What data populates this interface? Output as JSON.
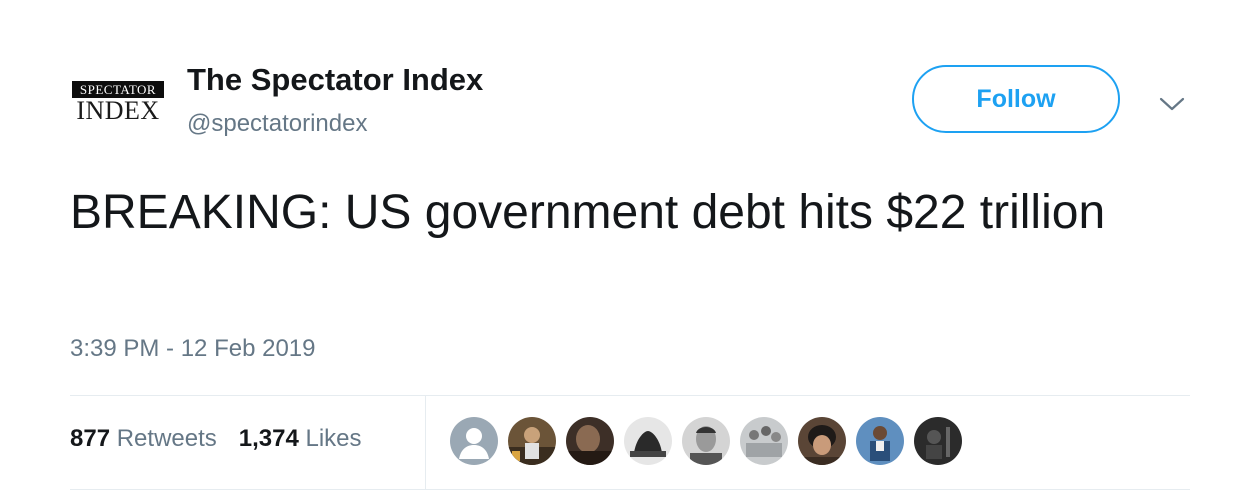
{
  "account": {
    "logo": {
      "top_text": "SPECTATOR",
      "bottom_text": "INDEX"
    },
    "name": "The Spectator Index",
    "handle": "@spectatorindex"
  },
  "follow_button": {
    "label": "Follow",
    "color": "#1da1f2"
  },
  "tweet": {
    "text": "BREAKING: US government debt hits $22 trillion",
    "timestamp": "3:39 PM - 12 Feb 2019"
  },
  "stats": {
    "retweets_count": "877",
    "retweets_label": "Retweets",
    "likes_count": "1,374",
    "likes_label": "Likes"
  },
  "likers": [
    {
      "name": "default-avatar",
      "color": "#9aa8b4"
    },
    {
      "name": "liker-avatar-2",
      "color": "#5b4a35"
    },
    {
      "name": "liker-avatar-3",
      "color": "#3d2f27"
    },
    {
      "name": "liker-avatar-4",
      "color": "#d8d8d8"
    },
    {
      "name": "liker-avatar-5",
      "color": "#cfcfcf"
    },
    {
      "name": "liker-avatar-6",
      "color": "#bfc3c6"
    },
    {
      "name": "liker-avatar-7",
      "color": "#4a3a30"
    },
    {
      "name": "liker-avatar-8",
      "color": "#2f5f8f"
    },
    {
      "name": "liker-avatar-9",
      "color": "#2b2b2b"
    }
  ],
  "colors": {
    "text": "#14171a",
    "secondary": "#657786",
    "divider": "#e6ecf0"
  }
}
